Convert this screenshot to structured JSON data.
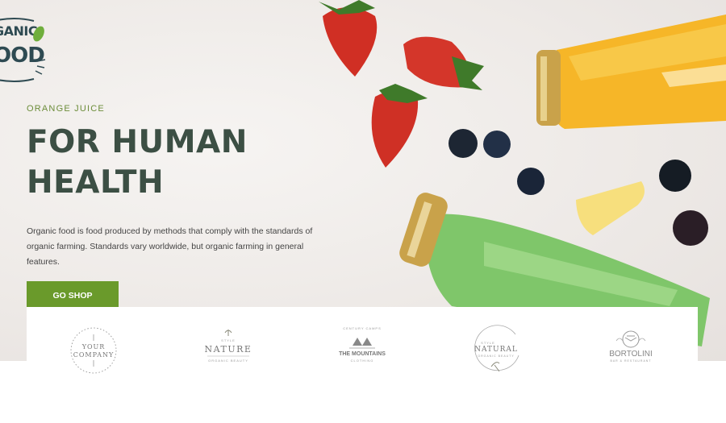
{
  "logo": {
    "line1": "GANIC",
    "line2": "OOD"
  },
  "hero": {
    "eyebrow": "ORANGE JUICE",
    "headline": "FOR HUMAN HEALTH",
    "description": "Organic food is food produced by methods that comply with the standards of organic farming. Standards vary worldwide, but organic farming in general features.",
    "cta_label": "GO SHOP"
  },
  "brands": [
    {
      "name": "YOUR COMPANY",
      "line1": "YOUR",
      "line2": "COMPANY"
    },
    {
      "name": "NATURE",
      "top": "STYLE",
      "main": "NATURE",
      "sub": "ORGANIC BEAUTY"
    },
    {
      "name": "THE MOUNTAINS",
      "top": "CENTURY CAMPS",
      "main": "THE MOUNTAINS",
      "sub": "CLOTHING"
    },
    {
      "name": "NATURAL",
      "top": "STYLE",
      "main": "NATURAL",
      "sub": "ORGANIC BEAUTY"
    },
    {
      "name": "BORTOLINI",
      "main": "BORTOLINI",
      "sub": "BAR & RESTAURANT"
    }
  ],
  "colors": {
    "accent": "#6a9a2b",
    "headline": "#3c4f44",
    "eyebrow": "#6c8d3a",
    "logo": "#2e4a52"
  }
}
